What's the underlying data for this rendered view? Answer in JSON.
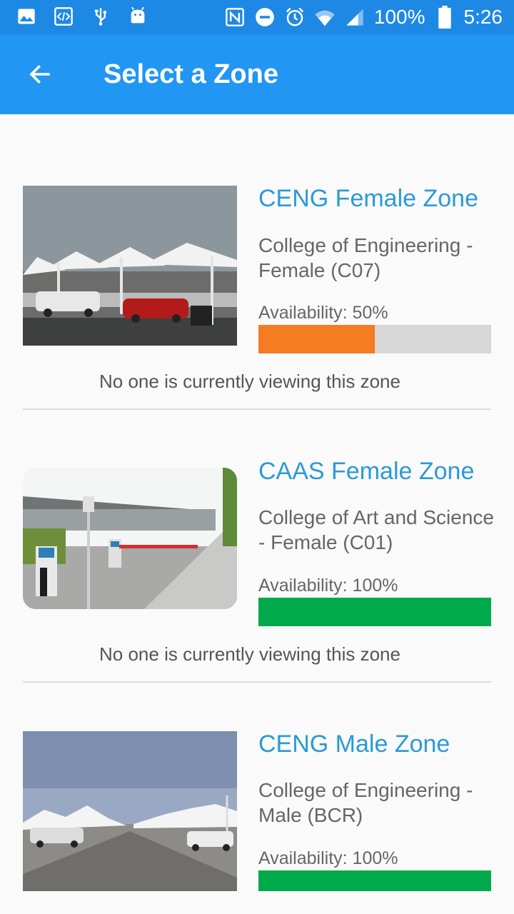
{
  "status_bar": {
    "battery_text": "100%",
    "time": "5:26",
    "icons": [
      "image-icon",
      "code-icon",
      "usb-icon",
      "android-icon",
      "nfc-icon",
      "do-not-disturb-icon",
      "alarm-icon",
      "wifi-icon",
      "signal-icon",
      "battery-icon"
    ]
  },
  "app_bar": {
    "title": "Select a Zone",
    "back_icon": "arrow-back-icon"
  },
  "colors": {
    "status_bar": "#1e88e5",
    "app_bar": "#2196f3",
    "title_text": "#2a9ad8",
    "bar_orange": "#f57c22",
    "bar_green": "#00a94a",
    "bar_track": "#d6d7d6"
  },
  "zones": [
    {
      "title": "CENG Female Zone",
      "description": "College of Engineering - Female (C07)",
      "availability_text": "Availability: 50%",
      "availability": 0.5,
      "bar_color": "#f57c22",
      "viewing_text": "No one is currently viewing this zone"
    },
    {
      "title": "CAAS Female Zone",
      "description": "College of Art and Science - Female (C01)",
      "availability_text": "Availability: 100%",
      "availability": 1.0,
      "bar_color": "#00a94a",
      "viewing_text": "No one is currently viewing this zone"
    },
    {
      "title": "CENG Male Zone",
      "description": "College of Engineering - Male (BCR)",
      "availability_text": "Availability: 100%",
      "availability": 1.0,
      "bar_color": "#00a94a"
    }
  ]
}
